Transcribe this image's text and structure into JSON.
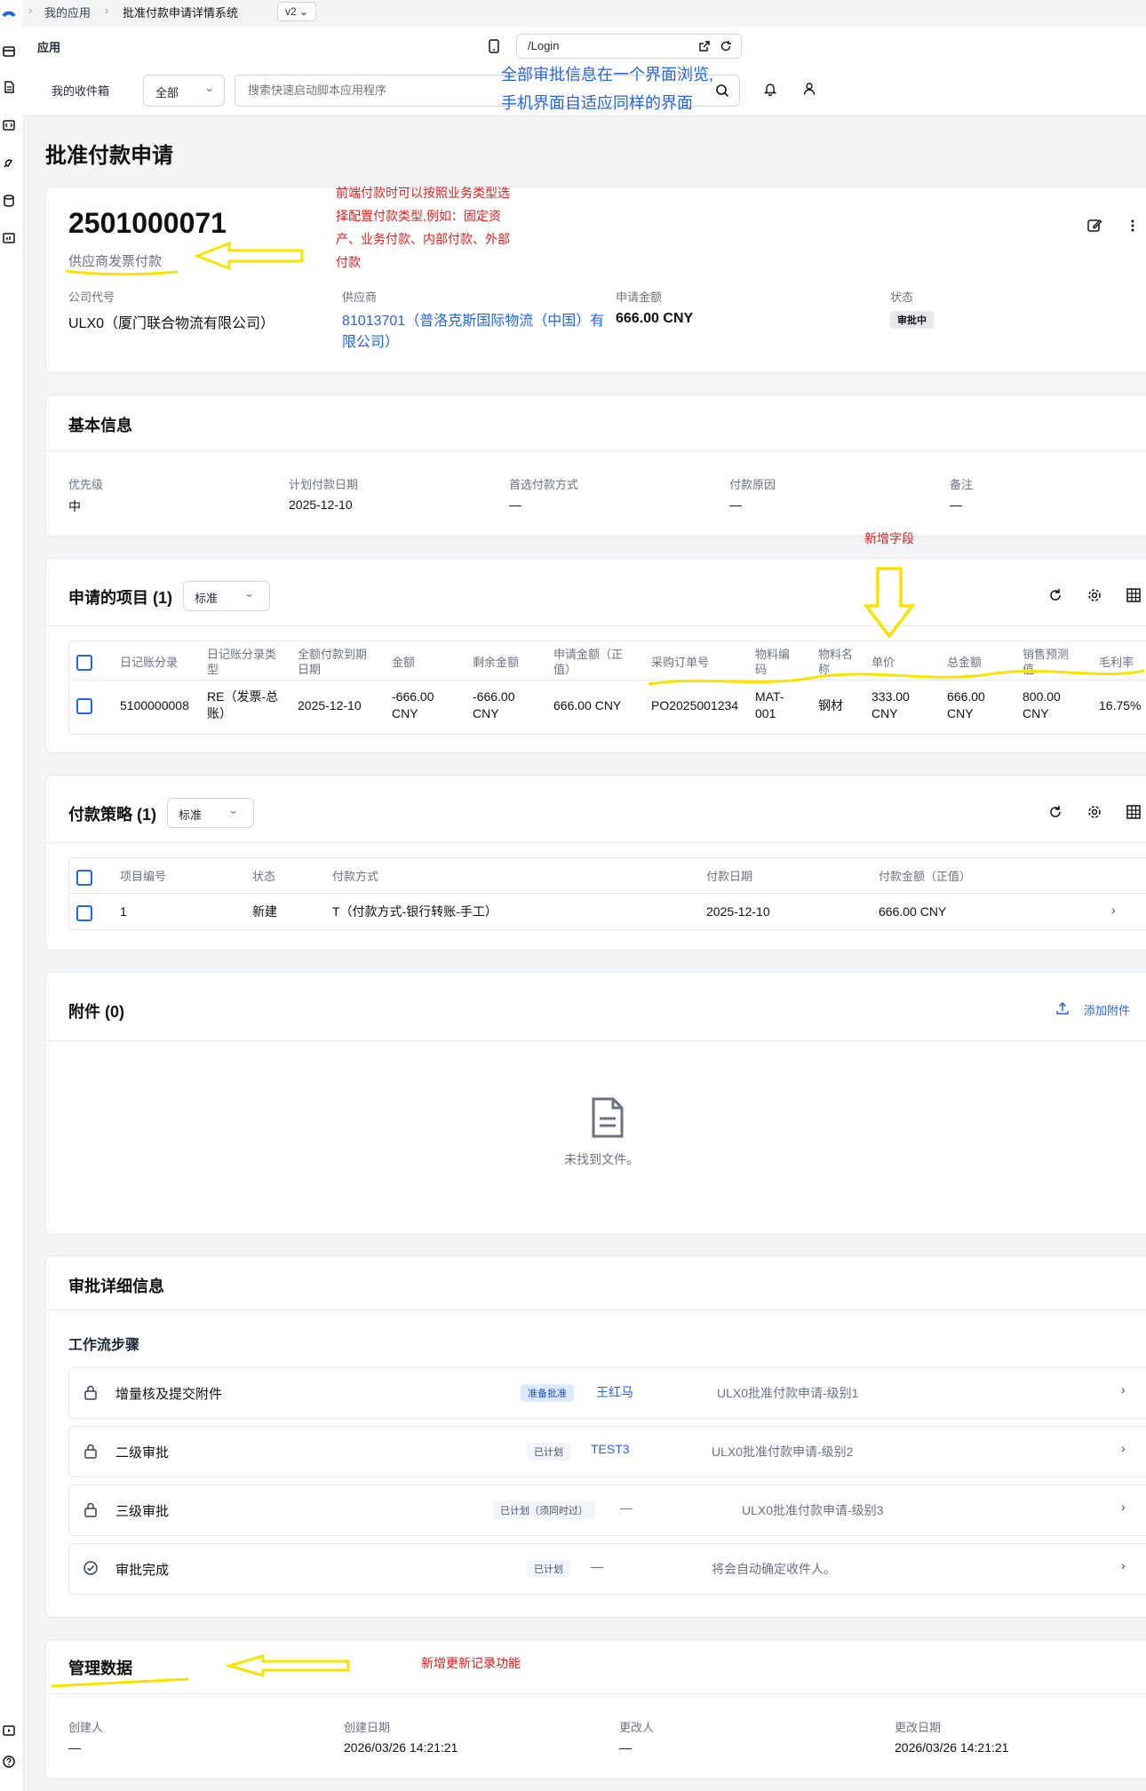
{
  "breadcrumb": {
    "home": "我的应用",
    "current": "批准付款申请详情系统",
    "version": "v2"
  },
  "appbar": {
    "title": "应用",
    "url": "/Login"
  },
  "toolbar": {
    "inbox": "我的收件箱",
    "filter": "全部",
    "search_placeholder": "搜索快速启动脚本应用程序"
  },
  "page_title": "批准付款申请",
  "header": {
    "doc_number": "2501000071",
    "doc_type": "供应商发票付款",
    "fields": [
      {
        "label": "公司代号",
        "value": "ULX0（厦门联合物流有限公司）"
      },
      {
        "label": "供应商",
        "value": "81013701（普洛克斯国际物流（中国）有限公司）"
      },
      {
        "label": "申请金额",
        "value": "666.00 CNY"
      },
      {
        "label": "状态",
        "value": "审批中"
      }
    ]
  },
  "basic": {
    "title": "基本信息",
    "fields": [
      {
        "label": "优先级",
        "value": "中"
      },
      {
        "label": "计划付款日期",
        "value": "2025-12-10"
      },
      {
        "label": "首选付款方式",
        "value": "—"
      },
      {
        "label": "付款原因",
        "value": "—"
      },
      {
        "label": "备注",
        "value": "—"
      }
    ]
  },
  "items": {
    "title": "申请的项目 (1)",
    "view": "标准",
    "headers": [
      "日记账分录",
      "日记账分录类型",
      "全额付款到期日期",
      "金额",
      "剩余金额",
      "申请金额（正值）",
      "采购订单号",
      "物料编码",
      "物料名称",
      "单价",
      "总金额",
      "销售预测值",
      "毛利率"
    ],
    "rows": [
      [
        "5100000008",
        "RE（发票-总账）",
        "2025-12-10",
        "-666.00 CNY",
        "-666.00 CNY",
        "666.00 CNY",
        "PO2025001234",
        "MAT-001",
        "钢材",
        "333.00 CNY",
        "666.00 CNY",
        "800.00 CNY",
        "16.75%"
      ]
    ]
  },
  "strategy": {
    "title": "付款策略 (1)",
    "view": "标准",
    "headers": [
      "项目编号",
      "状态",
      "付款方式",
      "付款日期",
      "付款金额（正值）"
    ],
    "rows": [
      [
        "1",
        "新建",
        "T（付款方式-银行转账-手工）",
        "2025-12-10",
        "666.00 CNY"
      ]
    ]
  },
  "attachments": {
    "title": "附件 (0)",
    "add": "添加附件",
    "empty": "未找到文件。"
  },
  "approval": {
    "title": "审批详细信息",
    "subtitle": "工作流步骤",
    "steps": [
      {
        "name": "增量核及提交附件",
        "status": "准备批准",
        "person": "王红马",
        "desc": "ULX0批准付款申请-级别1"
      },
      {
        "name": "二级审批",
        "status": "已计划",
        "person": "TEST3",
        "desc": "ULX0批准付款申请-级别2"
      },
      {
        "name": "三级审批",
        "status": "已计划（须同时过）",
        "person": "—",
        "desc": "ULX0批准付款申请-级别3"
      },
      {
        "name": "审批完成",
        "status": "已计划",
        "person": "—",
        "desc": "将会自动确定收件人。"
      }
    ]
  },
  "admin": {
    "title": "管理数据",
    "fields": [
      {
        "label": "创建人",
        "value": "—"
      },
      {
        "label": "创建日期",
        "value": "2026/03/26 14:21:21"
      },
      {
        "label": "更改人",
        "value": "—"
      },
      {
        "label": "更改日期",
        "value": "2026/03/26 14:21:21"
      }
    ]
  },
  "annotations": {
    "blue": [
      "全部审批信息在一个界面浏览,",
      "手机界面自适应同样的界面"
    ],
    "red_type": [
      "前端付款时可以按照业务类型选",
      "择配置付款类型,例如：固定资",
      "产、业务付款、内部付款、外部",
      "付款"
    ],
    "red_new_field": "新增字段",
    "red_admin": "新增更新记录功能"
  },
  "colors": {
    "link": "#2563eb",
    "annotation_yellow": "#f5e400",
    "annotation_red": "#e11d1d",
    "annotation_blue": "#2563eb"
  }
}
